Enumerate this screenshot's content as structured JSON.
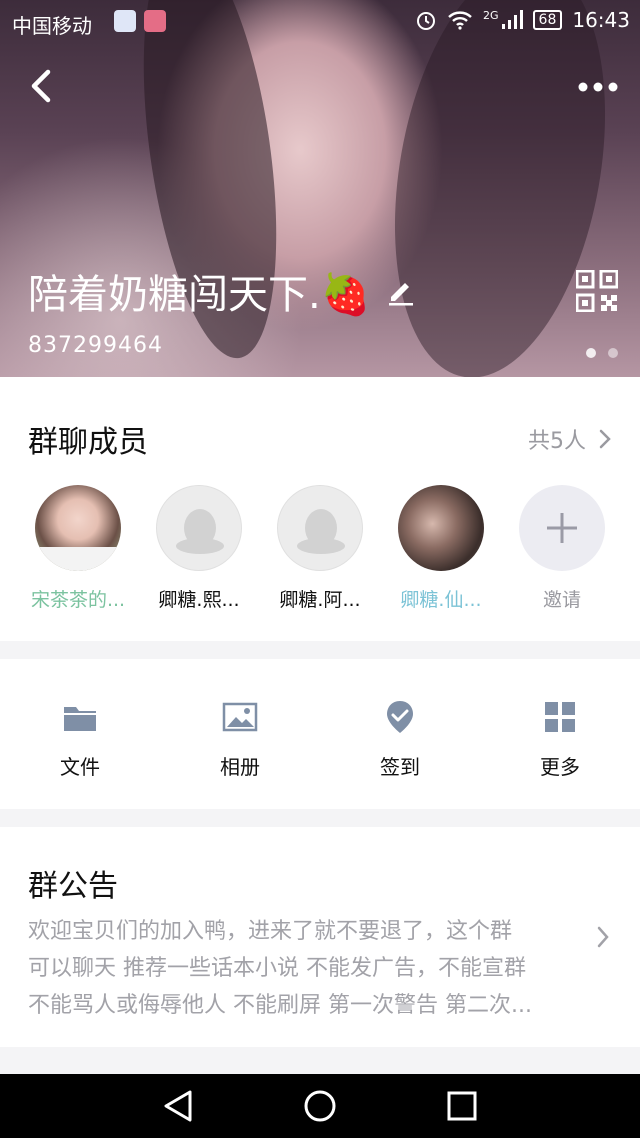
{
  "status_bar": {
    "carrier": "中国移动",
    "network": "2G",
    "battery": "68",
    "time": "16:43"
  },
  "header": {
    "group_name": "陪着奶糖闯天下.🍓",
    "group_id": "837299464",
    "page_dots": 2
  },
  "members": {
    "title": "群聊成员",
    "count_label": "共5人",
    "list": [
      {
        "name": "宋茶茶的...",
        "color": "#7cc3a0"
      },
      {
        "name": "卿糖.熙...",
        "color": "#111111"
      },
      {
        "name": "卿糖.阿...",
        "color": "#111111"
      },
      {
        "name": "卿糖.仙...",
        "color": "#7cc3d6"
      }
    ],
    "invite_label": "邀请"
  },
  "tools": [
    {
      "label": "文件",
      "icon": "folder-icon"
    },
    {
      "label": "相册",
      "icon": "image-icon"
    },
    {
      "label": "签到",
      "icon": "checkin-pin-icon"
    },
    {
      "label": "更多",
      "icon": "grid-icon"
    }
  ],
  "notice": {
    "title": "群公告",
    "lines": [
      "欢迎宝贝们的加入鸭，进来了就不要退了，这个群",
      "可以聊天 推荐一些话本小说 不能发广告，不能宣群",
      "不能骂人或侮辱他人 不能刷屏 第一次警告 第二次..."
    ]
  },
  "colors": {
    "accent_gray": "#9a9aa0",
    "divider": "#f4f4f6"
  }
}
